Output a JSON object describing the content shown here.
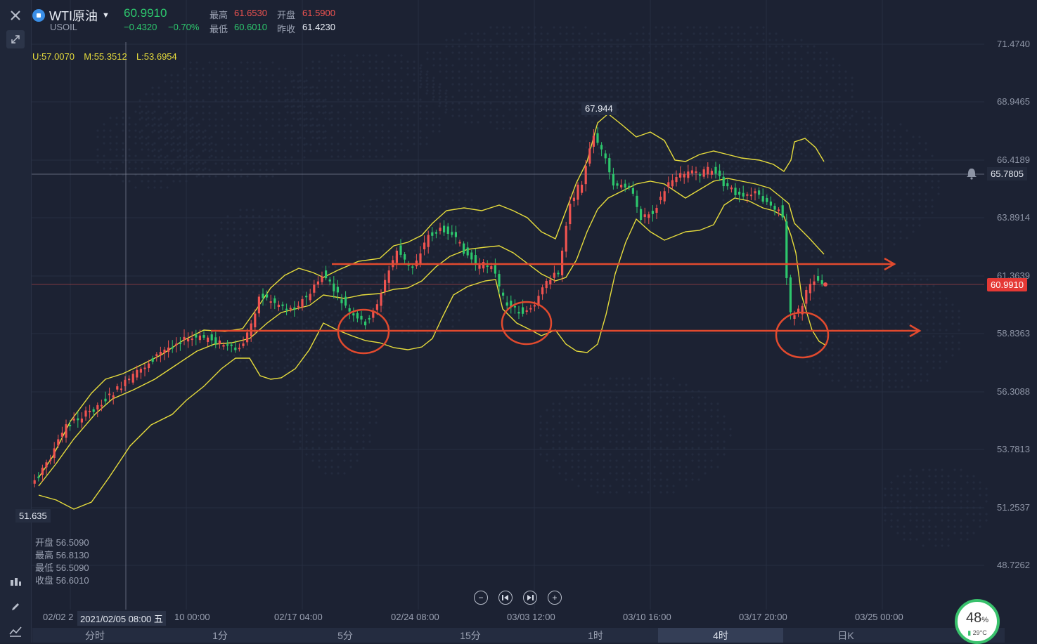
{
  "symbol": {
    "name": "WTI原油",
    "code": "USOIL",
    "last_price": "60.9910",
    "change": "−0.4320",
    "change_pct": "−0.70%"
  },
  "stats": {
    "high_label": "最高",
    "high": "61.6530",
    "open_label": "开盘",
    "open": "61.5900",
    "low_label": "最低",
    "low": "60.6010",
    "prev_close_label": "昨收",
    "prev_close": "61.4230"
  },
  "bollinger": {
    "upper": "U:57.0070",
    "middle": "M:55.3512",
    "lower": "L:53.6954"
  },
  "y_axis_labels": [
    "71.4740",
    "68.9465",
    "66.4189",
    "63.8914",
    "61.3639",
    "58.8363",
    "56.3088",
    "53.7813",
    "51.2537",
    "48.7262"
  ],
  "current_price_tag": "60.9910",
  "alert_price_tag": "65.7805",
  "peak_label": "67.944",
  "trough_label": "51.635",
  "crosshair_time": "2021/02/05 08:00 五",
  "x_axis_labels": [
    "02/02 2",
    "10 00:00",
    "02/17 04:00",
    "02/24 08:00",
    "03/03 12:00",
    "03/10 16:00",
    "03/17 20:00",
    "03/25 00:00"
  ],
  "ohlc_panel": [
    {
      "label": "开盘",
      "value": "56.5090"
    },
    {
      "label": "最高",
      "value": "56.8130"
    },
    {
      "label": "最低",
      "value": "56.5090"
    },
    {
      "label": "收盘",
      "value": "56.6010"
    }
  ],
  "timeframes": [
    "分时",
    "1分",
    "5分",
    "15分",
    "1时",
    "4时",
    "日K"
  ],
  "active_timeframe": "4时",
  "widget": {
    "percent": "48",
    "percent_sign": "%",
    "temperature": "29°C"
  },
  "colors": {
    "up": "#ef5350",
    "down": "#2dc76d",
    "band": "#e6dc3c",
    "annotation": "#e24a2e",
    "background": "#1c2233"
  },
  "icons": [
    "close-icon",
    "collapse-icon",
    "candlestick-icon",
    "pencil-icon",
    "indicator-icon",
    "zoom-out-icon",
    "step-back-icon",
    "step-forward-icon",
    "zoom-in-icon",
    "bell-icon"
  ]
}
